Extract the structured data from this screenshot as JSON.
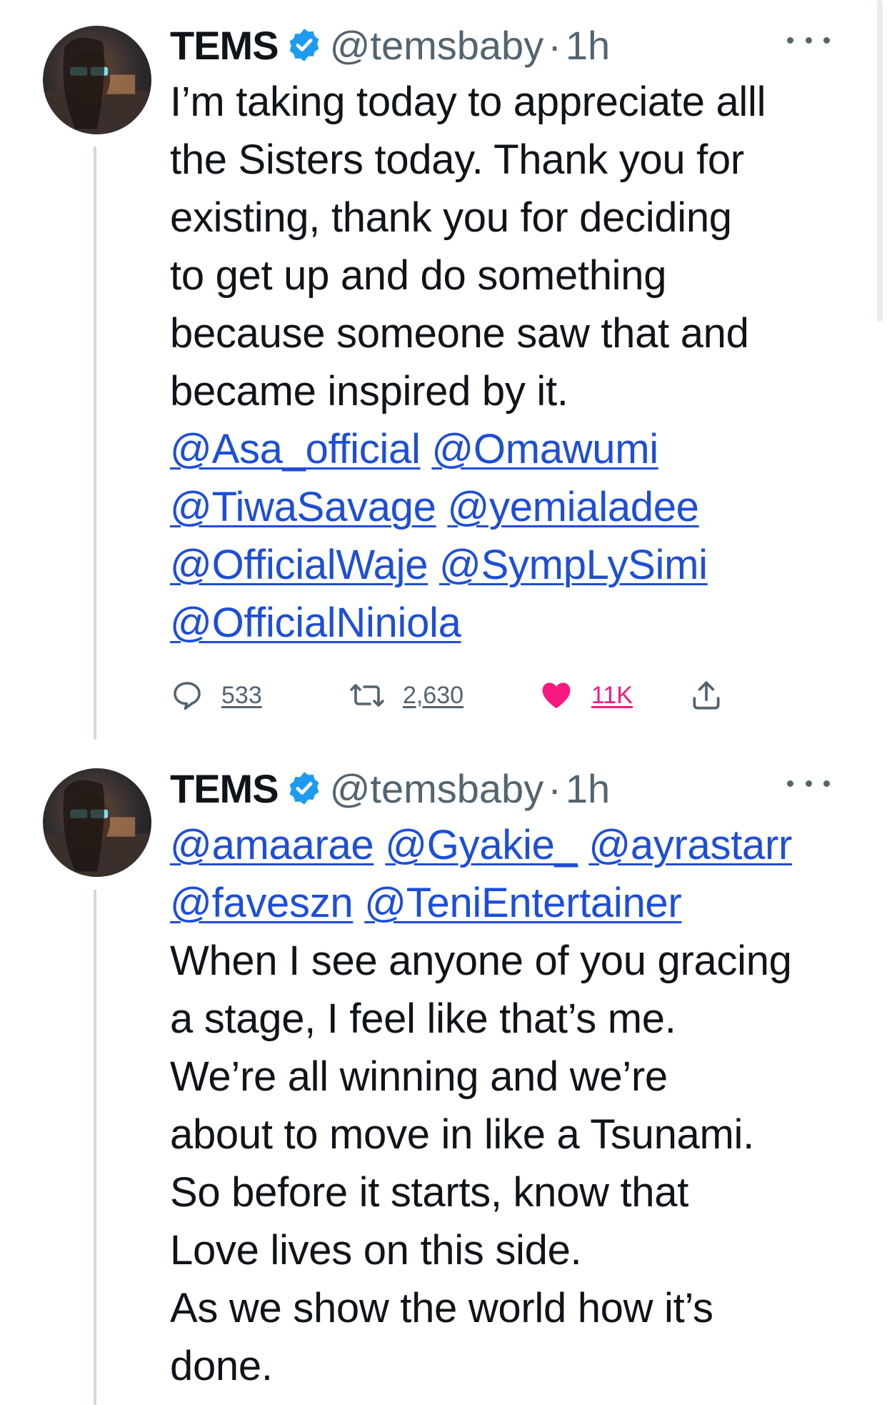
{
  "tweets": [
    {
      "author": {
        "name": "TEMS",
        "handle": "@temsbaby",
        "separator": "·",
        "time": "1h"
      },
      "text_lines": [
        "I’m taking today to appreciate alll",
        "the Sisters today. Thank you for",
        "existing, thank you for deciding",
        "to get up and do something",
        "because someone saw that and",
        "became inspired by it."
      ],
      "mention_lines": [
        [
          "@Asa_official",
          "@Omawumi"
        ],
        [
          "@TiwaSavage",
          "@yemialadee"
        ],
        [
          "@OfficialWaje",
          "@SympLySimi"
        ],
        [
          "@OfficialNiniola"
        ]
      ],
      "stats": {
        "replies": "533",
        "retweets": "2,630",
        "likes": "11K"
      }
    },
    {
      "author": {
        "name": "TEMS",
        "handle": "@temsbaby",
        "separator": "·",
        "time": "1h"
      },
      "mention_lines": [
        [
          "@amaarae",
          "@Gyakie_",
          "@ayrastarr"
        ],
        [
          "@faveszn",
          "@TeniEntertainer"
        ]
      ],
      "text_lines": [
        "When I see anyone of you gracing",
        "a stage, I feel like that’s me.",
        "We’re all winning and we’re",
        "about to move in like a Tsunami.",
        "So before it starts, know that",
        "Love lives on this side.",
        "As we show the world how it’s",
        "done."
      ]
    }
  ],
  "icons": {
    "verified": "verified-badge-icon",
    "more": "more-options-icon",
    "reply": "reply-icon",
    "retweet": "retweet-icon",
    "like": "heart-icon",
    "share": "share-icon"
  },
  "colors": {
    "verified": "#1d9bf0",
    "like": "#f91880",
    "mention": "#1d4ed8",
    "muted": "#536471",
    "thread_line": "#cfd9de"
  }
}
